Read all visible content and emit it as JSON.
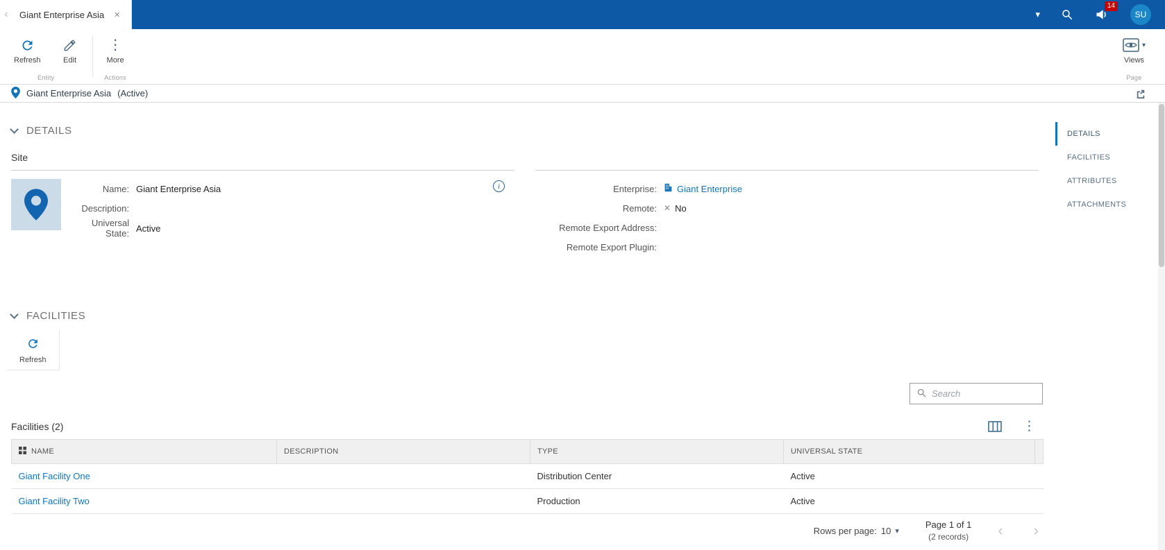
{
  "colors": {
    "accent": "#1474b8",
    "topbar": "#0d59a5",
    "badge": "#c40000",
    "avatar_bg": "#1b86c8"
  },
  "glyphs": {
    "close": "✕",
    "more": "⋮",
    "caret_down": "▾",
    "chevron_left": "‹",
    "chevron_right": "›",
    "x_mark": "✕",
    "info": "i"
  },
  "topbar": {
    "tab_title": "Giant Enterprise Asia",
    "notification_count": "14",
    "avatar_initials": "SU"
  },
  "ribbon": {
    "buttons": {
      "refresh": "Refresh",
      "edit": "Edit",
      "more": "More",
      "views": "Views"
    },
    "groups": {
      "entity": "Entity",
      "actions": "Actions",
      "page": "Page"
    }
  },
  "titlebar": {
    "title": "Giant Enterprise Asia",
    "state": "(Active)"
  },
  "side_nav": {
    "items": [
      {
        "label": "DETAILS"
      },
      {
        "label": "FACILITIES"
      },
      {
        "label": "ATTRIBUTES"
      },
      {
        "label": "ATTACHMENTS"
      }
    ]
  },
  "details": {
    "section_title": "DETAILS",
    "subsection_title": "Site",
    "left_fields": [
      {
        "label": "Name:",
        "value": "Giant Enterprise Asia"
      },
      {
        "label": "Description:",
        "value": ""
      },
      {
        "label": "Universal State:",
        "value": "Active"
      }
    ],
    "right_fields": [
      {
        "label": "Enterprise:",
        "value": "Giant Enterprise"
      },
      {
        "label": "Remote:",
        "value": "No"
      },
      {
        "label": "Remote Export Address:",
        "value": ""
      },
      {
        "label": "Remote Export Plugin:",
        "value": ""
      }
    ]
  },
  "facilities": {
    "section_title": "FACILITIES",
    "refresh_label": "Refresh",
    "search_placeholder": "Search",
    "table_title": "Facilities (2)",
    "columns": [
      "NAME",
      "DESCRIPTION",
      "TYPE",
      "UNIVERSAL STATE"
    ],
    "rows": [
      {
        "name": "Giant Facility One",
        "description": "",
        "type": "Distribution Center",
        "universal_state": "Active"
      },
      {
        "name": "Giant Facility Two",
        "description": "",
        "type": "Production",
        "universal_state": "Active"
      }
    ],
    "pagination": {
      "rows_per_page_label": "Rows per page:",
      "rows_per_page_value": "10",
      "page_label": "Page 1 of 1",
      "records_label": "(2 records)"
    }
  }
}
